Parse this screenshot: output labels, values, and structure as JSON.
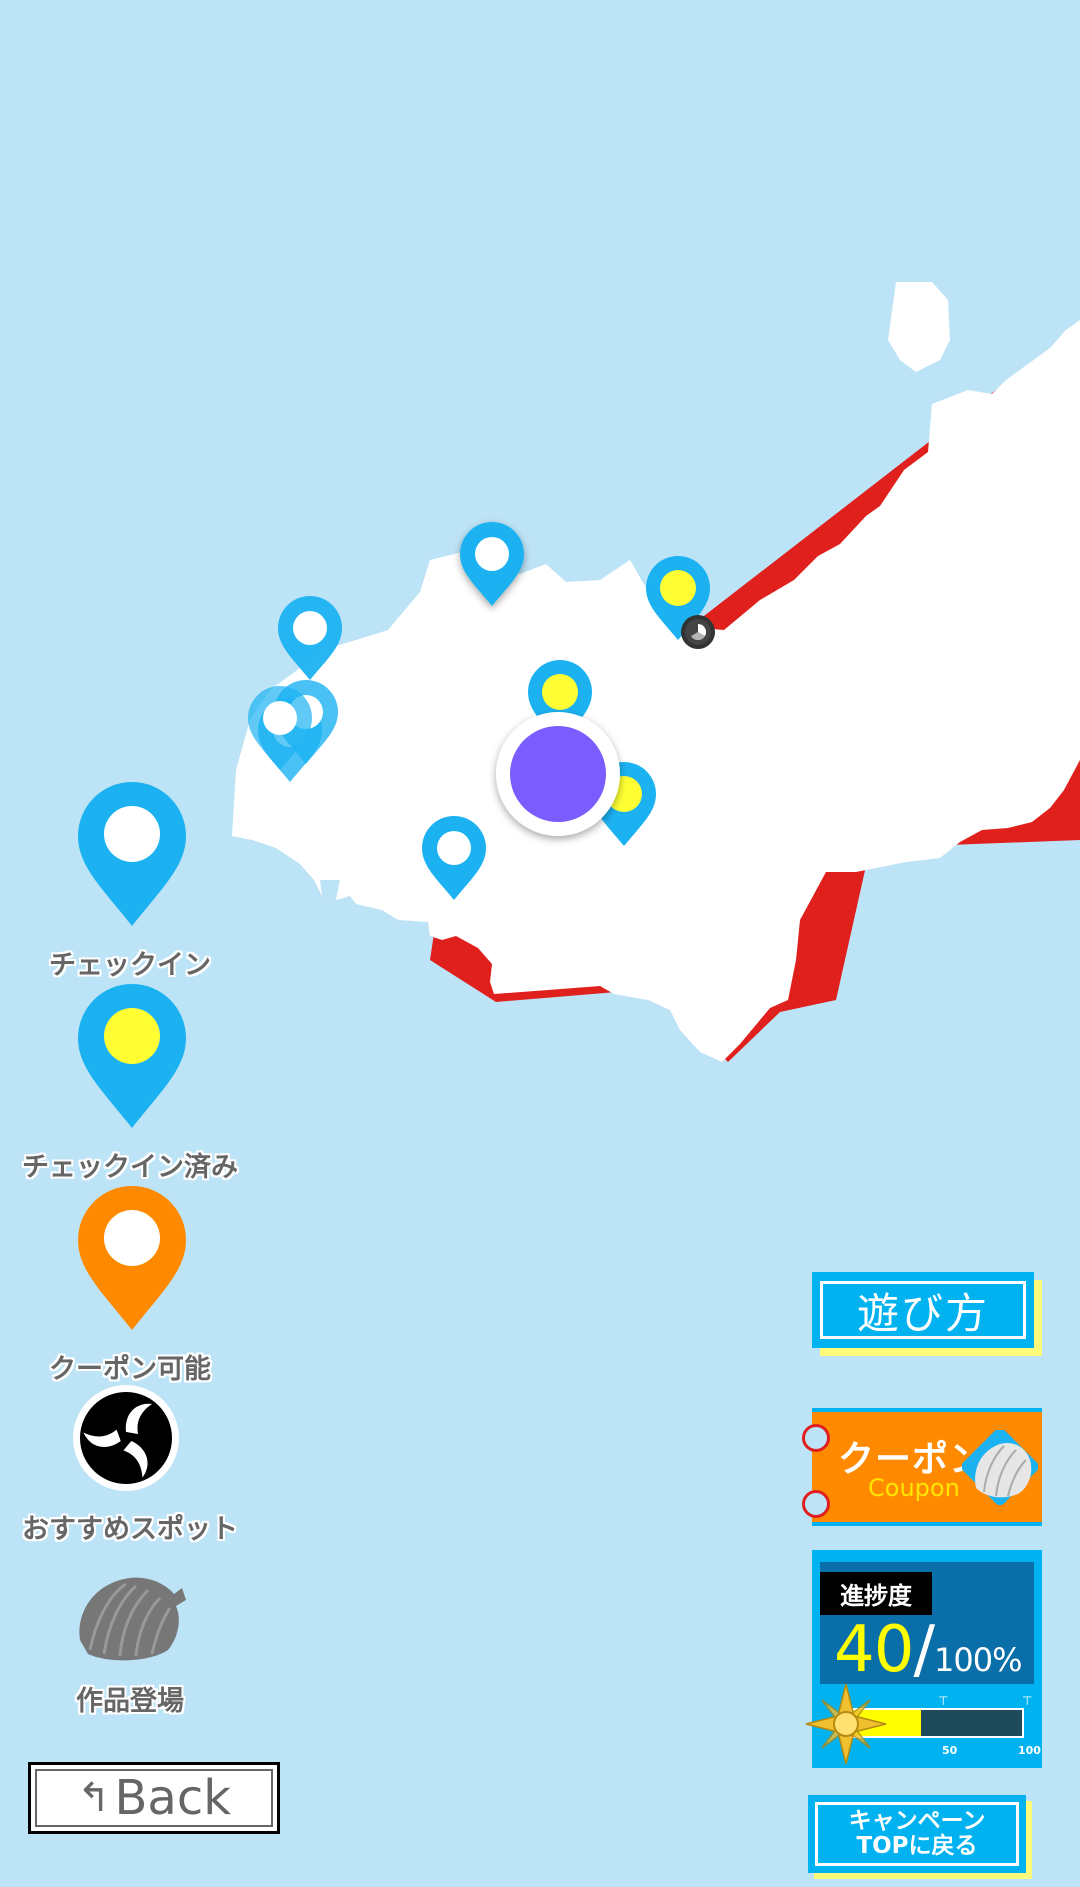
{
  "map": {
    "current_location_color": "#7a5cff",
    "checkin_color": "#1cb2f2",
    "checked_in_fill": "#ffff33",
    "coupon_color": "#ff8a00"
  },
  "legend": {
    "checkin": "チェックイン",
    "checked_in": "チェックイン済み",
    "coupon_available": "クーポン可能",
    "recommended_spot": "おすすめスポット",
    "work_appearance": "作品登場"
  },
  "buttons": {
    "how_to_play": "遊び方",
    "coupon_title": "クーポン",
    "coupon_sub": "Coupon",
    "campaign_top_line1": "キャンペーン",
    "campaign_top_line2": "TOPに戻る",
    "back": "Back"
  },
  "progress": {
    "tag": "進捗度",
    "value": "40",
    "separator": "/",
    "max_label": "100%",
    "fraction": 0.4,
    "tick_50": "50",
    "tick_100": "100"
  }
}
